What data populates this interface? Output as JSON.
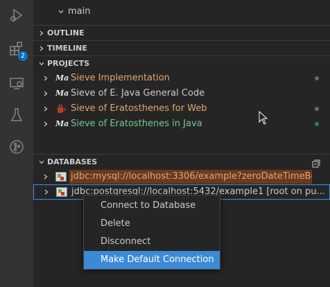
{
  "activity_bar": {
    "icons": [
      "run-debug-icon",
      "extensions-icon",
      "remote-explorer-icon",
      "testing-icon",
      "source-control-icon"
    ],
    "extensions_badge": "2"
  },
  "explorer": {
    "main_item": "main"
  },
  "sections": {
    "outline": "OUTLINE",
    "timeline": "TIMELINE",
    "projects": "PROJECTS",
    "databases": "DATABASES"
  },
  "projects": [
    {
      "label": "Sieve Implementation",
      "color": "#e2a76f",
      "icon": "maven-icon",
      "status_dot": "#7a6a4e"
    },
    {
      "label": "Sieve of E. Java General Code",
      "color": "#cccccc",
      "icon": "maven-icon",
      "status_dot": ""
    },
    {
      "label": "Sieve of Eratosthenes for Web",
      "color": "#e2a76f",
      "icon": "java-web-icon",
      "status_dot": "#7a6a4e"
    },
    {
      "label": "Sieve of Eratosthenes in Java",
      "color": "#73c991",
      "icon": "maven-icon",
      "status_dot": "#3d7a4e"
    }
  ],
  "databases": [
    {
      "label": "jdbc:mysql://localhost:3306/example?zeroDateTimeBe..."
    },
    {
      "label": "jdbc:postgresql://localhost:5432/example1 [root on pu..."
    }
  ],
  "context_menu": {
    "items": [
      "Connect to Database",
      "Delete",
      "Disconnect",
      "Make Default Connection"
    ],
    "highlighted_index": 3
  }
}
